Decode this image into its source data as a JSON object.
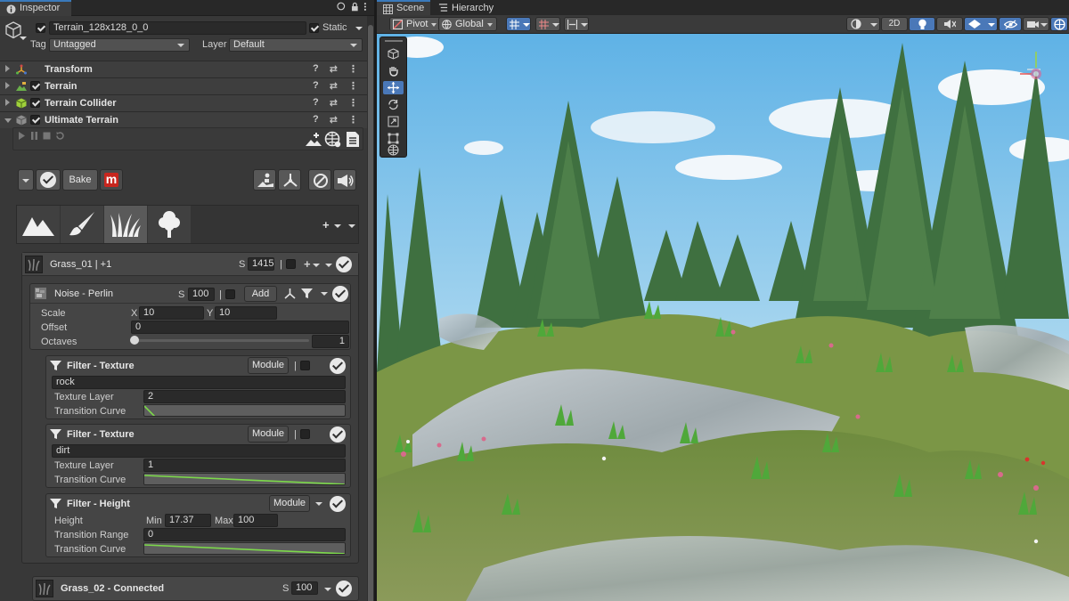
{
  "inspector": {
    "tab_title": "Inspector",
    "object_name": "Terrain_128x128_0_0",
    "static_label": "Static",
    "tag_label": "Tag",
    "tag_value": "Untagged",
    "layer_label": "Layer",
    "layer_value": "Default",
    "components": [
      {
        "label": "Transform",
        "expanded": false,
        "checkbox": false
      },
      {
        "label": "Terrain",
        "expanded": false,
        "checkbox": true
      },
      {
        "label": "Terrain Collider",
        "expanded": false,
        "checkbox": true
      },
      {
        "label": "Ultimate Terrain",
        "expanded": true,
        "checkbox": true
      }
    ],
    "component_tools": {
      "help": "?",
      "preset": "⇄",
      "more": "⋮"
    },
    "bake_label": "Bake",
    "m_label": "m",
    "add_menu": "+",
    "grass01": {
      "label": "Grass_01 | +1",
      "seed_label": "S",
      "seed_value": "1415",
      "pipe": "|",
      "add_menu": "+"
    },
    "noise": {
      "title": "Noise - Perlin",
      "seed_label": "S",
      "seed_value": "100",
      "pipe": "|",
      "add_label": "Add",
      "scale_label": "Scale",
      "x_label": "X",
      "x_value": "10",
      "y_label": "Y",
      "y_value": "10",
      "offset_label": "Offset",
      "offset_value": "0",
      "octaves_label": "Octaves",
      "octaves_value": "1"
    },
    "filter1": {
      "title": "Filter - Texture",
      "module_label": "Module",
      "pipe": "|",
      "name_value": "rock",
      "layer_label": "Texture Layer",
      "layer_value": "2",
      "curve_label": "Transition Curve"
    },
    "filter2": {
      "title": "Filter - Texture",
      "module_label": "Module",
      "pipe": "|",
      "name_value": "dirt",
      "layer_label": "Texture Layer",
      "layer_value": "1",
      "curve_label": "Transition Curve"
    },
    "filter3": {
      "title": "Filter - Height",
      "module_label": "Module",
      "height_label": "Height",
      "min_label": "Min",
      "min_value": "17.37",
      "max_label": "Max",
      "max_value": "100",
      "range_label": "Transition Range",
      "range_value": "0",
      "curve_label": "Transition Curve"
    },
    "grass02": {
      "label": "Grass_02 - Connected",
      "seed_label": "S",
      "seed_value": "100"
    }
  },
  "scene": {
    "tabs": [
      "Scene",
      "Hierarchy"
    ],
    "pivot_label": "Pivot",
    "global_label": "Global",
    "mode_2d": "2D",
    "tools": [
      "view-tool",
      "move-tool",
      "rotate-tool",
      "scale-tool",
      "rect-tool",
      "transform-tool"
    ]
  },
  "colors": {
    "accent": "#3a79bb",
    "selected_tool": "#4a78b8",
    "curve_line": "#7cd94a",
    "m_button": "#c8261e"
  }
}
